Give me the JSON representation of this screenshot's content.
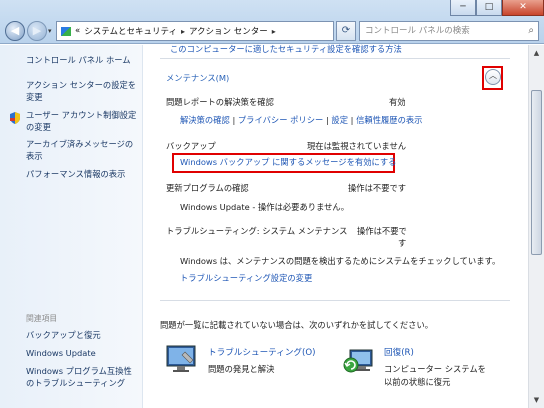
{
  "window": {
    "minimize_icon": "minimize-icon",
    "maximize_icon": "maximize-icon",
    "close_icon": "close-icon"
  },
  "address": {
    "overflow": "«",
    "crumbs": [
      "システムとセキュリティ",
      "アクション センター"
    ]
  },
  "search": {
    "placeholder": "コントロール パネルの検索"
  },
  "left_pane": {
    "items": [
      "コントロール パネル ホーム",
      "アクション センターの設定を変更",
      "ユーザー アカウント制御設定の変更",
      "アーカイブ済みメッセージの表示",
      "パフォーマンス情報の表示"
    ],
    "related_title": "関連項目",
    "related": [
      "バックアップと復元",
      "Windows Update",
      "Windows プログラム互換性のトラブルシューティング"
    ]
  },
  "main": {
    "top_link": "このコンピューターに適したセキュリティ設定を確認する方法",
    "maintenance_header": "メンテナンス(M)",
    "problem_report": {
      "label": "問題レポートの解決策を確認",
      "status": "有効",
      "links": [
        "解決策の確認",
        "プライバシー ポリシー",
        "設定",
        "信頼性履歴の表示"
      ],
      "separator": "|"
    },
    "backup": {
      "label": "バックアップ",
      "status": "現在は監視されていません",
      "link": "Windows バックアップ に関するメッセージを有効にする"
    },
    "update": {
      "label": "更新プログラムの確認",
      "status": "操作は不要です",
      "message": "Windows Update - 操作は必要ありません。"
    },
    "troubleshoot": {
      "label": "トラブルシューティング: システム メンテナンス",
      "status_line1": "操作は不要で",
      "status_line2": "す",
      "message": "Windows は、メンテナンスの問題を検出するためにシステムをチェックしています。",
      "link": "トラブルシューティング設定の変更"
    },
    "footer_prompt": "問題が一覧に記載されていない場合は、次のいずれかを試してください。",
    "actions": [
      {
        "title": "トラブルシューティング(O)",
        "desc": "問題の発見と解決"
      },
      {
        "title": "回復(R)",
        "desc_line1": "コンピューター システムを",
        "desc_line2": "以前の状態に復元"
      }
    ]
  },
  "colors": {
    "link": "#1e56b5",
    "highlight": "#e00000"
  }
}
